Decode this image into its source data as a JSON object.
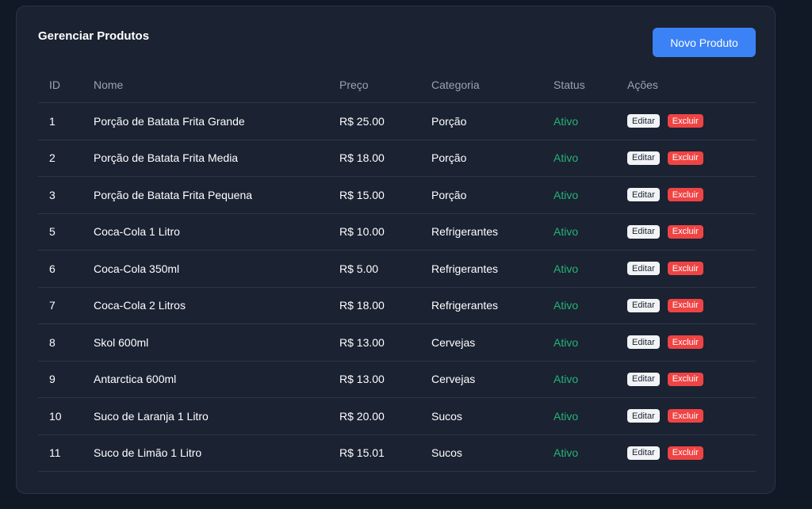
{
  "page": {
    "title": "Gerenciar Produtos",
    "new_button_label": "Novo Produto"
  },
  "table": {
    "headers": {
      "id": "ID",
      "name": "Nome",
      "price": "Preço",
      "category": "Categoria",
      "status": "Status",
      "actions": "Ações"
    },
    "rows": [
      {
        "id": "1",
        "name": "Porção de Batata Frita Grande",
        "price": "R$ 25.00",
        "category": "Porção",
        "status": "Ativo"
      },
      {
        "id": "2",
        "name": "Porção de Batata Frita Media",
        "price": "R$ 18.00",
        "category": "Porção",
        "status": "Ativo"
      },
      {
        "id": "3",
        "name": "Porção de Batata Frita Pequena",
        "price": "R$ 15.00",
        "category": "Porção",
        "status": "Ativo"
      },
      {
        "id": "5",
        "name": "Coca-Cola 1 Litro",
        "price": "R$ 10.00",
        "category": "Refrigerantes",
        "status": "Ativo"
      },
      {
        "id": "6",
        "name": "Coca-Cola 350ml",
        "price": "R$ 5.00",
        "category": "Refrigerantes",
        "status": "Ativo"
      },
      {
        "id": "7",
        "name": "Coca-Cola 2 Litros",
        "price": "R$ 18.00",
        "category": "Refrigerantes",
        "status": "Ativo"
      },
      {
        "id": "8",
        "name": "Skol 600ml",
        "price": "R$ 13.00",
        "category": "Cervejas",
        "status": "Ativo"
      },
      {
        "id": "9",
        "name": "Antarctica 600ml",
        "price": "R$ 13.00",
        "category": "Cervejas",
        "status": "Ativo"
      },
      {
        "id": "10",
        "name": "Suco de Laranja 1 Litro",
        "price": "R$ 20.00",
        "category": "Sucos",
        "status": "Ativo"
      },
      {
        "id": "11",
        "name": "Suco de Limão 1 Litro",
        "price": "R$ 15.01",
        "category": "Sucos",
        "status": "Ativo"
      }
    ],
    "edit_label": "Editar",
    "delete_label": "Excluir"
  },
  "colors": {
    "background": "#111826",
    "card": "#1b2232",
    "primary": "#3b82f6",
    "active_status": "#22b573",
    "danger": "#ef4444"
  }
}
